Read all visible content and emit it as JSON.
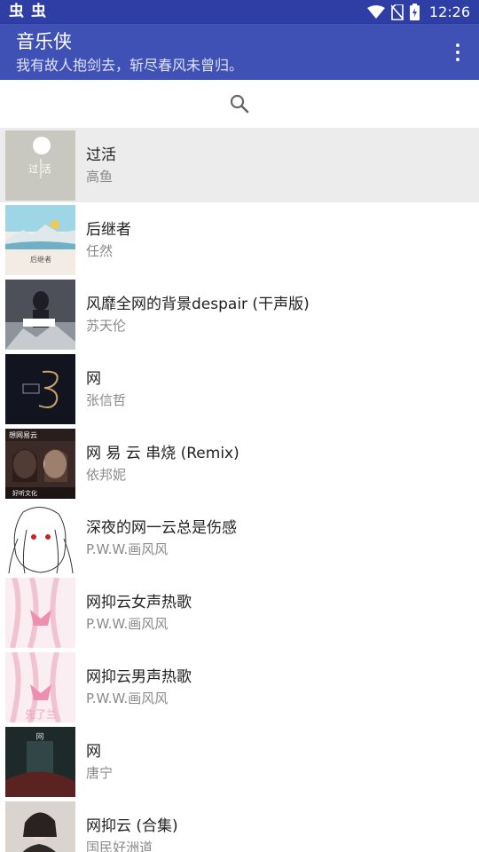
{
  "status_bar": {
    "left_icons": [
      "notification-icon",
      "notification-icon"
    ],
    "left_glyph": "虫",
    "time": "12:26",
    "right_icons": [
      "wifi-icon",
      "no-sim-icon",
      "battery-charging-icon"
    ]
  },
  "app_bar": {
    "title": "音乐侠",
    "subtitle": "我有故人抱剑去，斩尽春风未曾归。",
    "menu_icon": "overflow-menu-icon"
  },
  "search": {
    "icon": "search-icon"
  },
  "colors": {
    "status_bar": "#2f3ea5",
    "app_bar": "#3f51b5",
    "selected_row": "#ececec"
  },
  "songs": [
    {
      "title": "过活",
      "artist": "高鱼",
      "selected": true
    },
    {
      "title": "后继者",
      "artist": "任然",
      "selected": false
    },
    {
      "title": "风靡全网的背景despair (干声版)",
      "artist": "苏天伦",
      "selected": false
    },
    {
      "title": "网",
      "artist": "张信哲",
      "selected": false
    },
    {
      "title": "网 易 云 串烧 (Remix)",
      "artist": "依邦妮",
      "selected": false
    },
    {
      "title": "深夜的网一云总是伤感",
      "artist": "P.W.W.画风风",
      "selected": false
    },
    {
      "title": "网抑云女声热歌",
      "artist": "P.W.W.画风风",
      "selected": false
    },
    {
      "title": "网抑云男声热歌",
      "artist": "P.W.W.画风风",
      "selected": false
    },
    {
      "title": "网",
      "artist": "唐宁",
      "selected": false
    },
    {
      "title": "网抑云 (合集)",
      "artist": "国民好洲道",
      "selected": false
    }
  ],
  "cover_texts": {
    "c0": "过  活",
    "c1": "后继者",
    "c4_top": "想网易云",
    "c4_bottom": "好听文化",
    "c7": "先了兰",
    "c8": "网"
  }
}
